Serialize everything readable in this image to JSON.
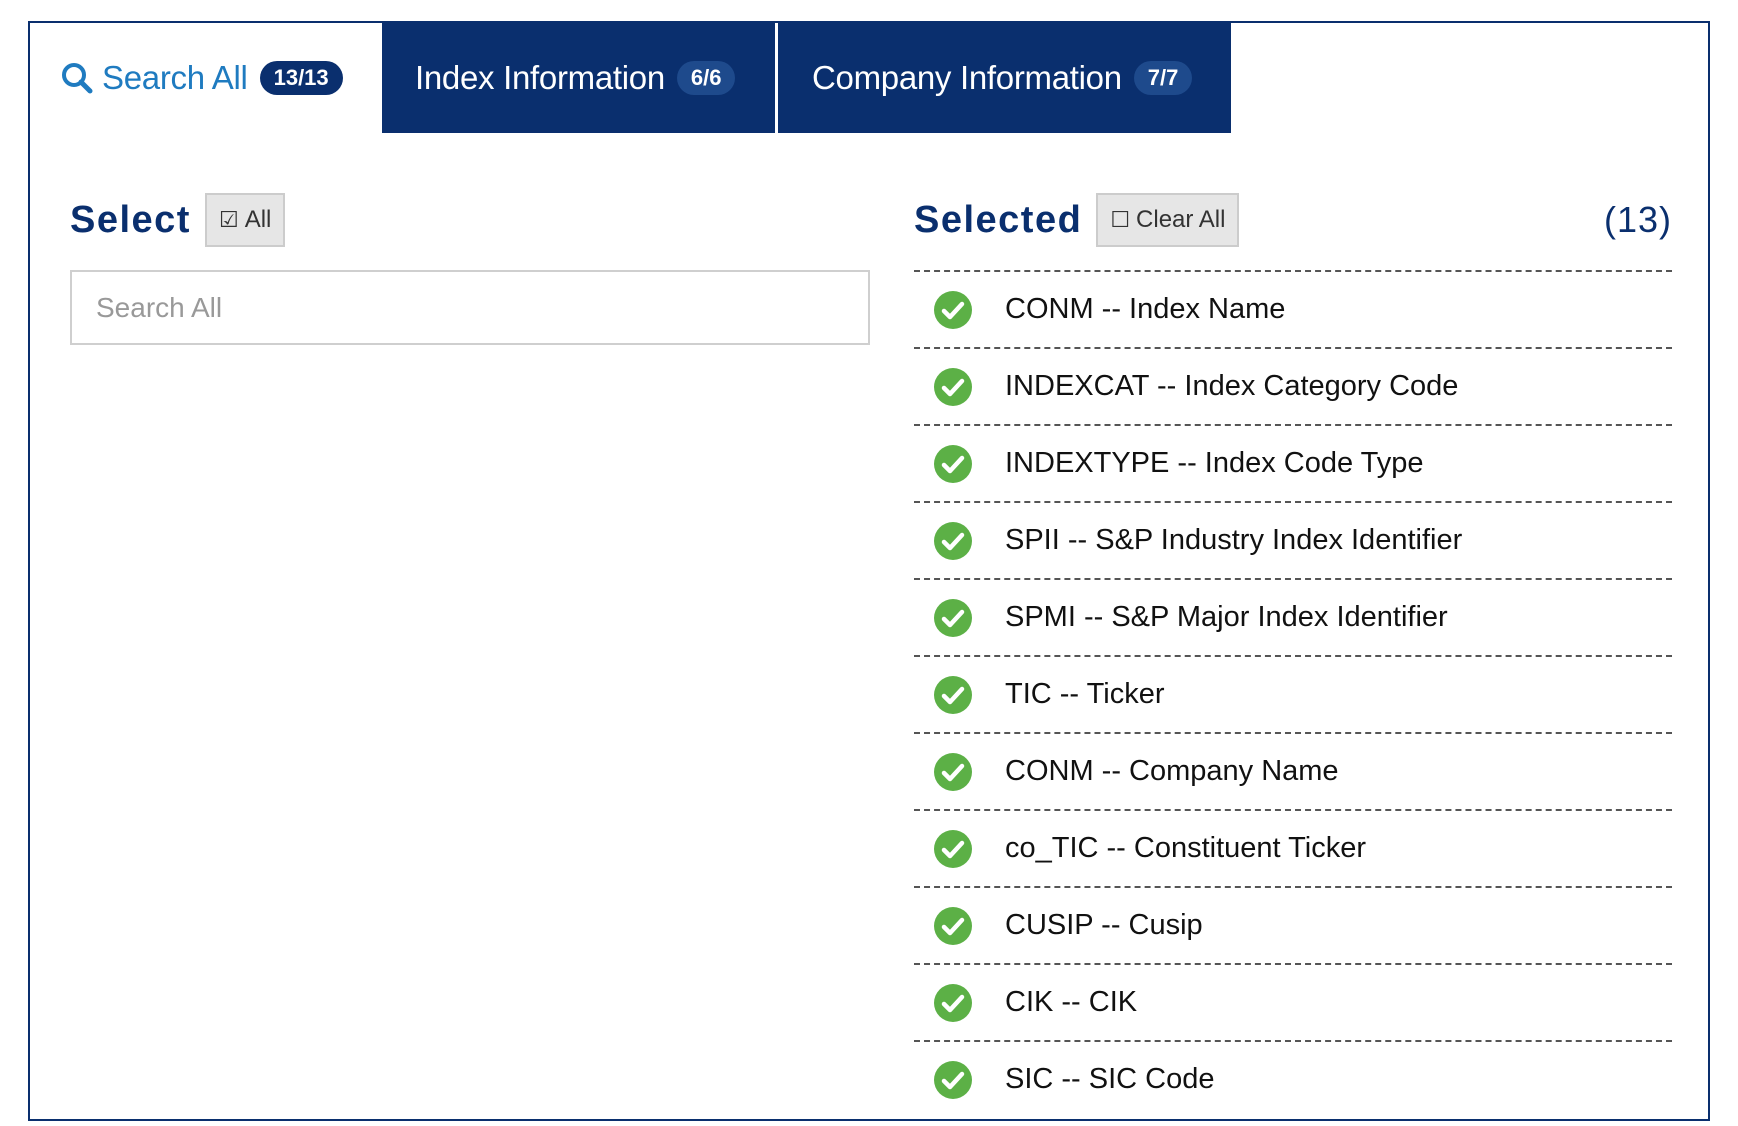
{
  "tabs": [
    {
      "label": "Search All",
      "badge": "13/13"
    },
    {
      "label": "Index Information",
      "badge": "6/6"
    },
    {
      "label": "Company Information",
      "badge": "7/7"
    }
  ],
  "left_panel": {
    "title": "Select",
    "all_button": "All",
    "search_placeholder": "Search All"
  },
  "right_panel": {
    "title": "Selected",
    "clear_button": "Clear All",
    "count": "(13)",
    "items": [
      "CONM -- Index Name",
      "INDEXCAT -- Index Category Code",
      "INDEXTYPE -- Index Code Type",
      "SPII -- S&P Industry Index Identifier",
      "SPMI -- S&P Major Index Identifier",
      "TIC -- Ticker",
      "CONM -- Company Name",
      "co_TIC -- Constituent Ticker",
      "CUSIP -- Cusip",
      "CIK -- CIK",
      "SIC -- SIC Code"
    ]
  },
  "colors": {
    "navy": "#0a2f6e",
    "link_blue": "#1f7bc0",
    "check_green": "#5cb046"
  }
}
